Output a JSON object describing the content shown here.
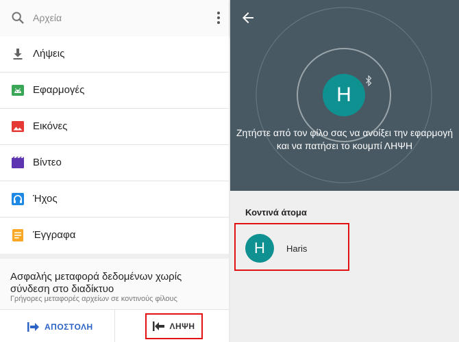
{
  "search": {
    "placeholder": "Αρχεία",
    "icon": "search-icon",
    "menu_icon": "more-vert-icon"
  },
  "categories": [
    {
      "label": "Λήψεις",
      "icon": "download-icon",
      "color": "#616161"
    },
    {
      "label": "Εφαρμογές",
      "icon": "android-icon",
      "color": "#3aa757"
    },
    {
      "label": "Εικόνες",
      "icon": "image-icon",
      "color": "#e53935"
    },
    {
      "label": "Βίντεο",
      "icon": "video-icon",
      "color": "#5e35b1"
    },
    {
      "label": "Ήχος",
      "icon": "headphones-icon",
      "color": "#1e88e5"
    },
    {
      "label": "Έγγραφα",
      "icon": "document-icon",
      "color": "#f9a825"
    }
  ],
  "promo": {
    "title": "Ασφαλής μεταφορά δεδομένων χωρίς σύνδεση στο διαδίκτυο",
    "subtitle": "Γρήγορες μεταφορές αρχείων σε κοντινούς φίλους"
  },
  "actions": {
    "send_label": "ΑΠΟΣΤΟΛΗ",
    "receive_label": "ΛΗΨΗ",
    "send_color": "#2b63c6",
    "highlight_color": "#e21010"
  },
  "receive_screen": {
    "avatar_letter": "H",
    "message": "Ζητήστε από τον φίλο σας να ανοίξει την εφαρμογή και να πατήσει το κουμπί ΛΗΨΗ",
    "background_color": "#485963",
    "avatar_color": "#0f9191"
  },
  "nearby": {
    "title": "Κοντινά άτομα",
    "people": [
      {
        "letter": "H",
        "name": "Haris"
      }
    ]
  }
}
